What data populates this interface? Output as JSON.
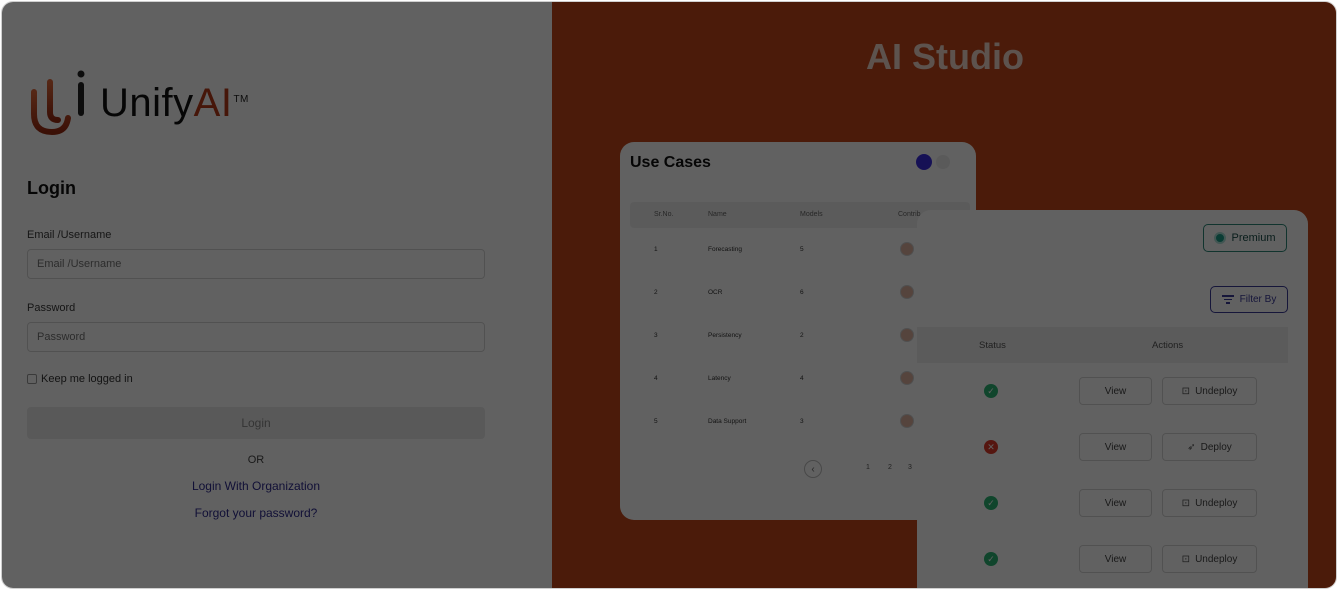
{
  "brand": {
    "name_main": "Unify",
    "name_accent": "AI",
    "trademark": "TM"
  },
  "login": {
    "title": "Login",
    "email_label": "Email /Username",
    "email_placeholder": "Email /Username",
    "password_label": "Password",
    "password_placeholder": "Password",
    "remember_label": "Keep me logged in",
    "login_button": "Login",
    "or_text": "OR",
    "org_link": "Login With Organization",
    "forgot_link": "Forgot your password?"
  },
  "showcase": {
    "title": "AI Studio",
    "use_cases": {
      "title": "Use Cases",
      "columns": [
        "Sr.No.",
        "Name",
        "Models",
        "Contrib"
      ],
      "rows": [
        {
          "sr": "1",
          "name": "Forecasting",
          "models": "5"
        },
        {
          "sr": "2",
          "name": "OCR",
          "models": "6"
        },
        {
          "sr": "3",
          "name": "Persistency",
          "models": "2"
        },
        {
          "sr": "4",
          "name": "Latency",
          "models": "4"
        },
        {
          "sr": "5",
          "name": "Data Support",
          "models": "3"
        }
      ],
      "pager": {
        "prev": "‹",
        "pages": [
          "1",
          "2",
          "3"
        ]
      }
    },
    "deploy": {
      "premium_label": "Premium",
      "filter_label": "Filter By",
      "col_status": "Status",
      "col_actions": "Actions",
      "rows": [
        {
          "status": "ok",
          "view": "View",
          "action": "Undeploy"
        },
        {
          "status": "error",
          "view": "View",
          "action": "Deploy"
        },
        {
          "status": "ok",
          "view": "View",
          "action": "Undeploy"
        },
        {
          "status": "ok",
          "view": "View",
          "action": "Undeploy"
        }
      ]
    }
  },
  "colors": {
    "brand_accent": "#b73a1a",
    "panel_bg": "#c4481c",
    "link": "#2e2a8f",
    "premium": "#1c9e88",
    "status_ok": "#2bb673",
    "status_error": "#e03b2b"
  }
}
